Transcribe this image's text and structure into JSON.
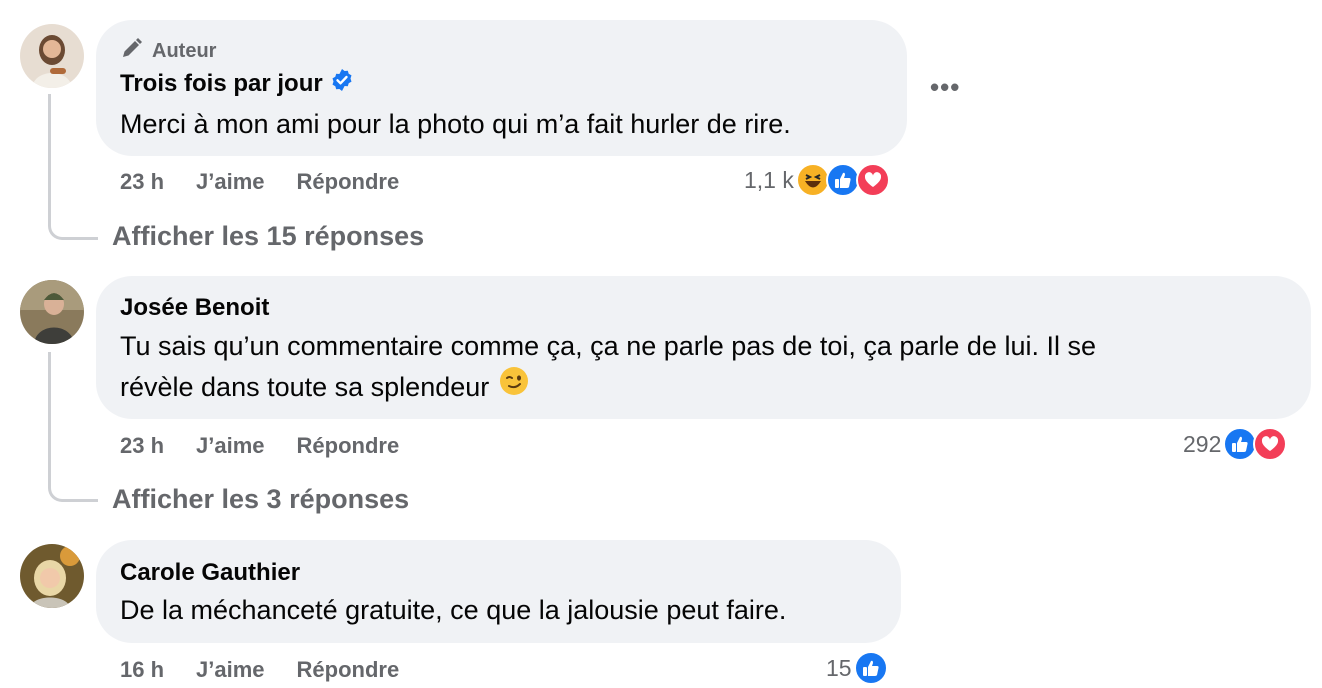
{
  "comments": [
    {
      "role": "Auteur",
      "author": "Trois fois par jour",
      "text": "Merci à mon ami pour la photo qui m’a fait hurler de rire.",
      "time": "23 h",
      "like": "J’aime",
      "reply": "Répondre",
      "reaction_count": "1,1 k",
      "reactions": [
        "haha-icon",
        "like-icon",
        "love-icon"
      ],
      "show_replies": "Afficher les 15 réponses",
      "more": "•••"
    },
    {
      "author": "Josée Benoit",
      "text_line1": "Tu sais qu’un commentaire comme ça, ça ne parle pas de toi, ça parle de lui. Il se",
      "text_line2": "révèle dans toute sa splendeur",
      "time": "23 h",
      "like": "J’aime",
      "reply": "Répondre",
      "reaction_count": "292",
      "reactions": [
        "like-icon",
        "love-icon"
      ],
      "show_replies": "Afficher les 3 réponses"
    },
    {
      "author": "Carole Gauthier",
      "text": "De la méchanceté gratuite, ce que la jalousie peut faire.",
      "time": "16 h",
      "like": "J’aime",
      "reply": "Répondre",
      "reaction_count": "15",
      "reactions": [
        "like-icon"
      ]
    }
  ],
  "colors": {
    "bubble": "#f0f2f5",
    "secondary_text": "#65676b",
    "like_blue": "#1877f2",
    "love_red": "#f33e58",
    "haha_yellow": "#f7b125",
    "verified_blue": "#1877f2"
  }
}
